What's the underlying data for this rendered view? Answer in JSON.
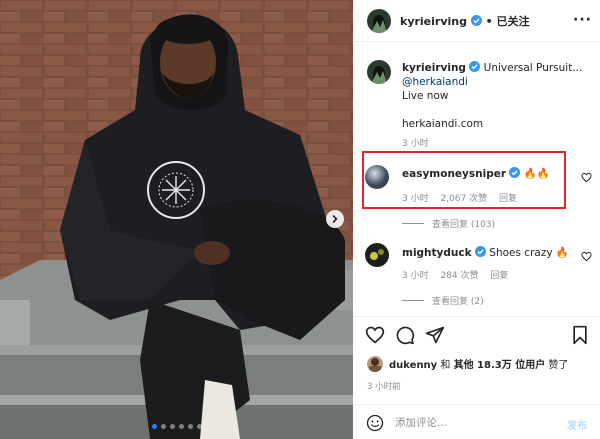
{
  "post": {
    "author": "kyrieirving",
    "follow_separator": "•",
    "follow_label": "已关注",
    "more_label": "···",
    "caption": {
      "username": "kyrieirving",
      "text": "Universal Pursuit...",
      "mention": "@herkaiandi",
      "line2": "Live now",
      "line3": "herkaiandi.com",
      "time": "3 小时"
    },
    "comments": [
      {
        "username": "easymoneysniper",
        "text": "🔥🔥",
        "time": "3 小时",
        "likes": "2,067 次赞",
        "reply": "回复",
        "view_replies": "查看回复 (103)"
      },
      {
        "username": "mightyduck",
        "text": "Shoes crazy 🔥",
        "time": "3 小时",
        "likes": "284 次赞",
        "reply": "回复",
        "view_replies": "查看回复 (2)"
      }
    ],
    "liked_by": {
      "user": "dukenny",
      "and": "和",
      "others": "其他 18.3万 位用户",
      "suffix": "赞了"
    },
    "post_time": "3 小时前",
    "comment_box": {
      "placeholder": "添加评论...",
      "post_label": "发布"
    }
  },
  "carousel": {
    "slides": 6,
    "active_slide": 1
  },
  "colors": {
    "verified": "#3897f0",
    "link": "#00376b",
    "highlight": "#e0242c",
    "post_button": "#b2dffc"
  },
  "icons": [
    "verified-icon",
    "more-icon",
    "heart-icon",
    "comment-icon",
    "share-icon",
    "save-icon",
    "emoji-icon",
    "next-arrow-icon"
  ]
}
